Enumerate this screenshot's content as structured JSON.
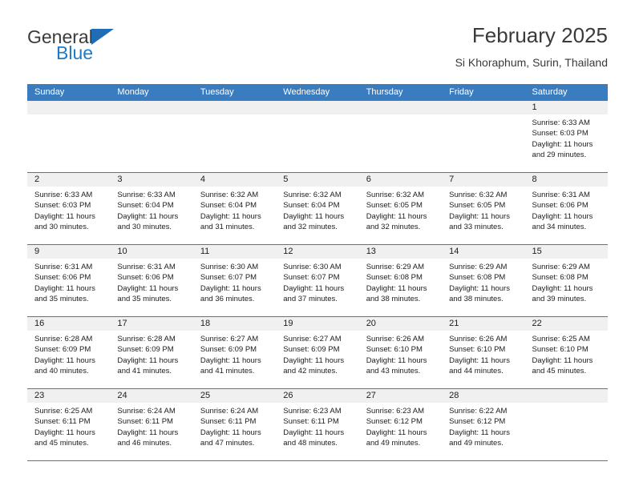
{
  "brand": {
    "name_line1": "General",
    "name_line2": "Blue",
    "accent_color": "#2079c4",
    "triangle_icon": "blue-triangle-logo-mark"
  },
  "header": {
    "title": "February 2025",
    "subtitle": "Si Khoraphum, Surin, Thailand"
  },
  "calendar": {
    "header_bg": "#3a7cc0",
    "weekday_headers": [
      "Sunday",
      "Monday",
      "Tuesday",
      "Wednesday",
      "Thursday",
      "Friday",
      "Saturday"
    ],
    "weeks": [
      [
        {
          "day": "",
          "empty": true
        },
        {
          "day": "",
          "empty": true
        },
        {
          "day": "",
          "empty": true
        },
        {
          "day": "",
          "empty": true
        },
        {
          "day": "",
          "empty": true
        },
        {
          "day": "",
          "empty": true
        },
        {
          "day": "1",
          "sunrise": "Sunrise: 6:33 AM",
          "sunset": "Sunset: 6:03 PM",
          "daylight": "Daylight: 11 hours and 29 minutes."
        }
      ],
      [
        {
          "day": "2",
          "sunrise": "Sunrise: 6:33 AM",
          "sunset": "Sunset: 6:03 PM",
          "daylight": "Daylight: 11 hours and 30 minutes."
        },
        {
          "day": "3",
          "sunrise": "Sunrise: 6:33 AM",
          "sunset": "Sunset: 6:04 PM",
          "daylight": "Daylight: 11 hours and 30 minutes."
        },
        {
          "day": "4",
          "sunrise": "Sunrise: 6:32 AM",
          "sunset": "Sunset: 6:04 PM",
          "daylight": "Daylight: 11 hours and 31 minutes."
        },
        {
          "day": "5",
          "sunrise": "Sunrise: 6:32 AM",
          "sunset": "Sunset: 6:04 PM",
          "daylight": "Daylight: 11 hours and 32 minutes."
        },
        {
          "day": "6",
          "sunrise": "Sunrise: 6:32 AM",
          "sunset": "Sunset: 6:05 PM",
          "daylight": "Daylight: 11 hours and 32 minutes."
        },
        {
          "day": "7",
          "sunrise": "Sunrise: 6:32 AM",
          "sunset": "Sunset: 6:05 PM",
          "daylight": "Daylight: 11 hours and 33 minutes."
        },
        {
          "day": "8",
          "sunrise": "Sunrise: 6:31 AM",
          "sunset": "Sunset: 6:06 PM",
          "daylight": "Daylight: 11 hours and 34 minutes."
        }
      ],
      [
        {
          "day": "9",
          "sunrise": "Sunrise: 6:31 AM",
          "sunset": "Sunset: 6:06 PM",
          "daylight": "Daylight: 11 hours and 35 minutes."
        },
        {
          "day": "10",
          "sunrise": "Sunrise: 6:31 AM",
          "sunset": "Sunset: 6:06 PM",
          "daylight": "Daylight: 11 hours and 35 minutes."
        },
        {
          "day": "11",
          "sunrise": "Sunrise: 6:30 AM",
          "sunset": "Sunset: 6:07 PM",
          "daylight": "Daylight: 11 hours and 36 minutes."
        },
        {
          "day": "12",
          "sunrise": "Sunrise: 6:30 AM",
          "sunset": "Sunset: 6:07 PM",
          "daylight": "Daylight: 11 hours and 37 minutes."
        },
        {
          "day": "13",
          "sunrise": "Sunrise: 6:29 AM",
          "sunset": "Sunset: 6:08 PM",
          "daylight": "Daylight: 11 hours and 38 minutes."
        },
        {
          "day": "14",
          "sunrise": "Sunrise: 6:29 AM",
          "sunset": "Sunset: 6:08 PM",
          "daylight": "Daylight: 11 hours and 38 minutes."
        },
        {
          "day": "15",
          "sunrise": "Sunrise: 6:29 AM",
          "sunset": "Sunset: 6:08 PM",
          "daylight": "Daylight: 11 hours and 39 minutes."
        }
      ],
      [
        {
          "day": "16",
          "sunrise": "Sunrise: 6:28 AM",
          "sunset": "Sunset: 6:09 PM",
          "daylight": "Daylight: 11 hours and 40 minutes."
        },
        {
          "day": "17",
          "sunrise": "Sunrise: 6:28 AM",
          "sunset": "Sunset: 6:09 PM",
          "daylight": "Daylight: 11 hours and 41 minutes."
        },
        {
          "day": "18",
          "sunrise": "Sunrise: 6:27 AM",
          "sunset": "Sunset: 6:09 PM",
          "daylight": "Daylight: 11 hours and 41 minutes."
        },
        {
          "day": "19",
          "sunrise": "Sunrise: 6:27 AM",
          "sunset": "Sunset: 6:09 PM",
          "daylight": "Daylight: 11 hours and 42 minutes."
        },
        {
          "day": "20",
          "sunrise": "Sunrise: 6:26 AM",
          "sunset": "Sunset: 6:10 PM",
          "daylight": "Daylight: 11 hours and 43 minutes."
        },
        {
          "day": "21",
          "sunrise": "Sunrise: 6:26 AM",
          "sunset": "Sunset: 6:10 PM",
          "daylight": "Daylight: 11 hours and 44 minutes."
        },
        {
          "day": "22",
          "sunrise": "Sunrise: 6:25 AM",
          "sunset": "Sunset: 6:10 PM",
          "daylight": "Daylight: 11 hours and 45 minutes."
        }
      ],
      [
        {
          "day": "23",
          "sunrise": "Sunrise: 6:25 AM",
          "sunset": "Sunset: 6:11 PM",
          "daylight": "Daylight: 11 hours and 45 minutes."
        },
        {
          "day": "24",
          "sunrise": "Sunrise: 6:24 AM",
          "sunset": "Sunset: 6:11 PM",
          "daylight": "Daylight: 11 hours and 46 minutes."
        },
        {
          "day": "25",
          "sunrise": "Sunrise: 6:24 AM",
          "sunset": "Sunset: 6:11 PM",
          "daylight": "Daylight: 11 hours and 47 minutes."
        },
        {
          "day": "26",
          "sunrise": "Sunrise: 6:23 AM",
          "sunset": "Sunset: 6:11 PM",
          "daylight": "Daylight: 11 hours and 48 minutes."
        },
        {
          "day": "27",
          "sunrise": "Sunrise: 6:23 AM",
          "sunset": "Sunset: 6:12 PM",
          "daylight": "Daylight: 11 hours and 49 minutes."
        },
        {
          "day": "28",
          "sunrise": "Sunrise: 6:22 AM",
          "sunset": "Sunset: 6:12 PM",
          "daylight": "Daylight: 11 hours and 49 minutes."
        },
        {
          "day": "",
          "empty": true
        }
      ]
    ]
  }
}
